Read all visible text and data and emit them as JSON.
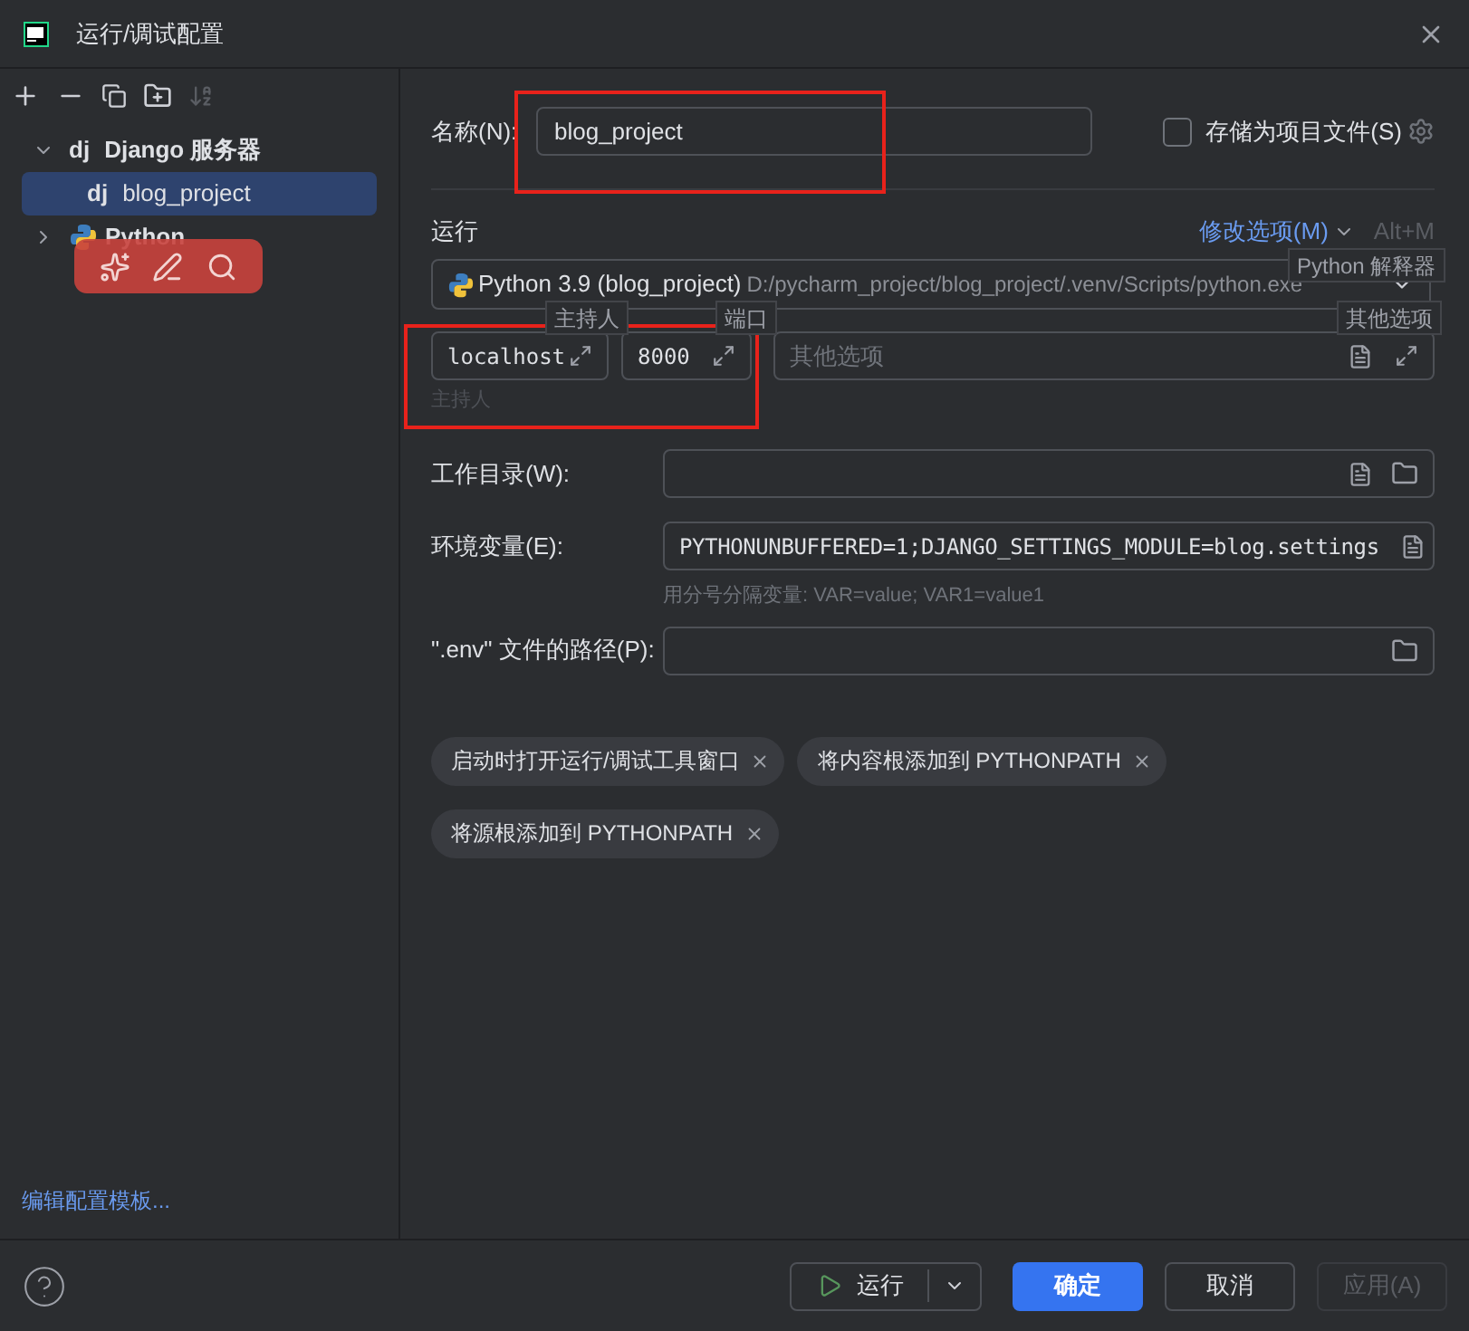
{
  "window": {
    "title": "运行/调试配置"
  },
  "toolbar": {
    "sort_disabled": true
  },
  "tree": [
    {
      "label": "Django 服务器",
      "prefix": "dj",
      "expanded": true,
      "selected": false,
      "children": [
        {
          "label": "blog_project",
          "prefix": "dj",
          "selected": true
        }
      ]
    },
    {
      "label": "Python",
      "expanded": false,
      "selected": false
    }
  ],
  "edit_templates_link": "编辑配置模板...",
  "name_field": {
    "label": "名称(N):",
    "value": "blog_project"
  },
  "store_as_project_file": {
    "label": "存储为项目文件(S)",
    "checked": false
  },
  "run_section": {
    "title": "运行",
    "modify_options": "修改选项(M)",
    "shortcut": "Alt+M"
  },
  "interpreter": {
    "name": "Python 3.9 (blog_project)",
    "path": "D:/pycharm_project/blog_project/.venv/Scripts/python.exe"
  },
  "host_field": {
    "value": "localhost"
  },
  "port_field": {
    "value": "8000"
  },
  "options_field": {
    "placeholder": "其他选项"
  },
  "tooltips": [
    {
      "text": "Python 解释器"
    },
    {
      "text": "主持人"
    },
    {
      "text": "端口"
    },
    {
      "text": "其他选项"
    }
  ],
  "host_hint": "主持人",
  "working_dir": {
    "label": "工作目录(W):"
  },
  "env_vars": {
    "label": "环境变量(E):",
    "value": "PYTHONUNBUFFERED=1;DJANGO_SETTINGS_MODULE=blog.settings",
    "hint": "用分号分隔变量: VAR=value; VAR1=value1"
  },
  "env_file": {
    "label": "\".env\" 文件的路径(P):"
  },
  "chips": [
    {
      "label": "启动时打开运行/调试工具窗口"
    },
    {
      "label": "将内容根添加到 PYTHONPATH"
    },
    {
      "label": "将源根添加到 PYTHONPATH"
    }
  ],
  "footer": {
    "run": "运行",
    "ok": "确定",
    "cancel": "取消",
    "apply": {
      "label": "应用(A)",
      "disabled": true
    }
  }
}
